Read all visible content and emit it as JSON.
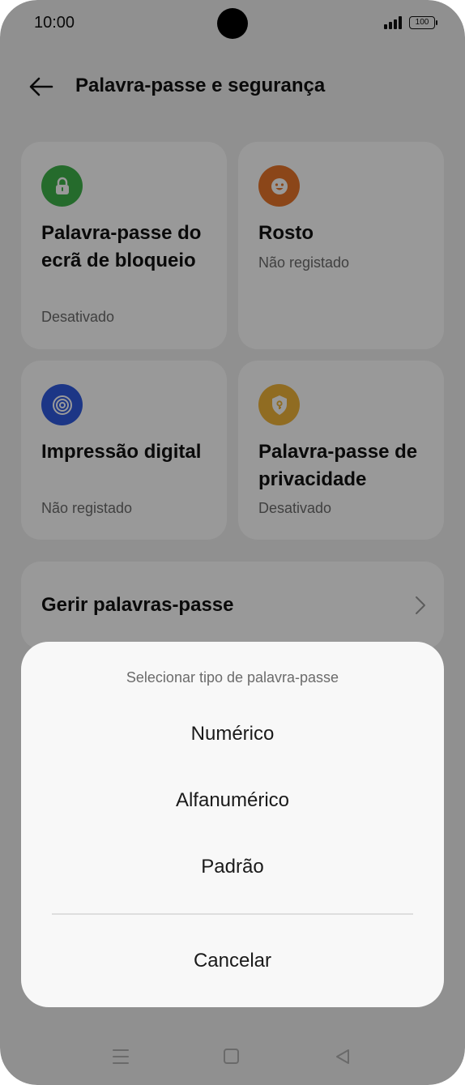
{
  "status_bar": {
    "time": "10:00",
    "battery": "100"
  },
  "header": {
    "title": "Palavra-passe e segurança",
    "back_icon": "arrow-left-icon"
  },
  "cards": [
    {
      "title": "Palavra-passe do ecrã de bloqueio",
      "status": "Desativado",
      "icon": "lock-icon",
      "color": "#3fb24a"
    },
    {
      "title": "Rosto",
      "status": "Não registado",
      "icon": "face-icon",
      "color": "#e8762b"
    },
    {
      "title": "Impressão digital",
      "status": "Não registado",
      "icon": "fingerprint-icon",
      "color": "#2f5ae0"
    },
    {
      "title": "Palavra-passe de privacidade",
      "status": "Desativado",
      "icon": "shield-key-icon",
      "color": "#f0b43a"
    }
  ],
  "manage": {
    "label": "Gerir palavras-passe"
  },
  "sheet": {
    "title": "Selecionar tipo de palavra-passe",
    "options": [
      "Numérico",
      "Alfanumérico",
      "Padrão"
    ],
    "cancel": "Cancelar"
  }
}
